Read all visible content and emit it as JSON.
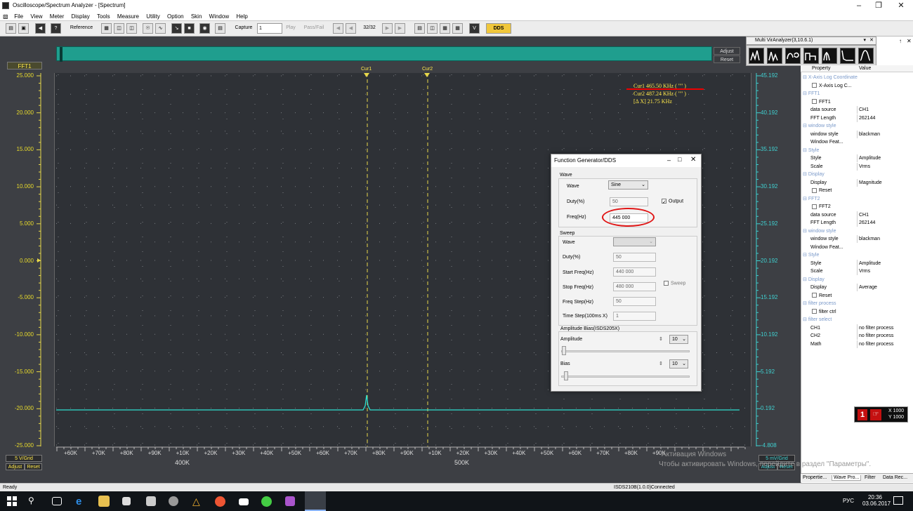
{
  "window": {
    "title": "Oscilloscope/Spectrum Analyzer - [Spectrum]"
  },
  "menu": [
    "File",
    "View",
    "Meter",
    "Display",
    "Tools",
    "Measure",
    "Utility",
    "Option",
    "Skin",
    "Window",
    "Help"
  ],
  "toolbar": {
    "reference": "Reference",
    "capture": "Capture",
    "capture_value": "1",
    "play": "Play",
    "pass_fail": "Pass/Fail",
    "frame": "32/32",
    "dds": "DDS"
  },
  "plot": {
    "channel_label": "FFT1",
    "y_left": [
      "25.000",
      "20.000",
      "15.000",
      "10.000",
      "5.000",
      "0.000",
      "-5.000",
      "-10.000",
      "-15.000",
      "-20.000",
      "-25.000"
    ],
    "y_right": [
      "45.192",
      "40.192",
      "35.192",
      "30.192",
      "25.192",
      "20.192",
      "15.192",
      "10.192",
      "5.192",
      "0.192",
      "-4.808"
    ],
    "x_ticks": [
      "+60K",
      "+70K",
      "+80K",
      "+90K",
      "+10K",
      "+20K",
      "+30K",
      "+40K",
      "+50K",
      "+60K",
      "+70K",
      "+80K",
      "+90K",
      "+10K",
      "+20K",
      "+30K",
      "+40K",
      "+50K",
      "+60K",
      "+70K",
      "+80K",
      "+90K"
    ],
    "x_groups": [
      "400K",
      "500K"
    ],
    "left_grid": "5 V/Grid",
    "right_grid": "5 mV/Grid",
    "adjust": "Adjust",
    "reset": "Reset",
    "cur1_tag": "Cur1",
    "cur2_tag": "Cur2",
    "cur1_line": "Cur1   465.50 KHz ( \"\" )",
    "cur2_line": "Cur2   487.24 KHz ( \"\" )",
    "delta_line": "[Δ X]   21.75 KHz"
  },
  "watermark": {
    "line1": "Активация Windows",
    "line2": "Чтобы активировать Windows, перейдите в раздел \"Параметры\"."
  },
  "fg": {
    "title": "Function Generator/DDS",
    "wave_group": "Wave",
    "wave_label": "Wave",
    "wave_value": "Sine",
    "duty_label": "Duty(%)",
    "duty_value": "50",
    "output_label": "Output",
    "freq_label": "Freq(Hz)",
    "freq_value": "445 000",
    "sweep_group": "Sweep",
    "s_wave": "Wave",
    "s_duty": "Duty(%)",
    "s_duty_value": "50",
    "start_label": "Start Freq(Hz)",
    "start_value": "440 000",
    "stop_label": "Stop Freq(Hz)",
    "stop_value": "480 000",
    "sweep_chk": "Sweep",
    "step_label": "Freq Step(Hz)",
    "step_value": "50",
    "time_label": "Time Step(100ms X)",
    "time_value": "1",
    "amp_group": "Amplitude Bias(ISDS205X)",
    "amp_label": "Amplitude",
    "amp_value": "10",
    "bias_label": "Bias",
    "bias_value": "10"
  },
  "mva": {
    "title": "Multi VirAnalyzer(3,10.6.1)"
  },
  "props": {
    "col_property": "Property",
    "col_value": "Value",
    "rows": [
      {
        "k": "X-Axis Log Coordinate",
        "v": "",
        "cat": true
      },
      {
        "k": "X-Axis Log C...",
        "v": "",
        "chk": true
      },
      {
        "k": "FFT1",
        "v": "",
        "cat": true
      },
      {
        "k": "FFT1",
        "v": "",
        "chk": true
      },
      {
        "k": "data source",
        "v": "CH1"
      },
      {
        "k": "FFT Length",
        "v": "262144"
      },
      {
        "k": "window style",
        "v": "",
        "cat": true
      },
      {
        "k": "window style",
        "v": "blackman"
      },
      {
        "k": "Window Feat...",
        "v": ""
      },
      {
        "k": "Style",
        "v": "",
        "cat": true
      },
      {
        "k": "Style",
        "v": "Amplitude"
      },
      {
        "k": "Scale",
        "v": "Vrms"
      },
      {
        "k": "Display",
        "v": "",
        "cat": true
      },
      {
        "k": "Display",
        "v": "Magnitude"
      },
      {
        "k": "Reset",
        "v": "",
        "chk": true
      },
      {
        "k": "FFT2",
        "v": "",
        "cat": true
      },
      {
        "k": "FFT2",
        "v": "",
        "chk": true
      },
      {
        "k": "data source",
        "v": "CH1"
      },
      {
        "k": "FFT Length",
        "v": "262144"
      },
      {
        "k": "window style",
        "v": "",
        "cat": true
      },
      {
        "k": "window style",
        "v": "blackman"
      },
      {
        "k": "Window Feat...",
        "v": ""
      },
      {
        "k": "Style",
        "v": "",
        "cat": true
      },
      {
        "k": "Style",
        "v": "Amplitude"
      },
      {
        "k": "Scale",
        "v": "Vrms"
      },
      {
        "k": "Display",
        "v": "",
        "cat": true
      },
      {
        "k": "Display",
        "v": "Average"
      },
      {
        "k": "Reset",
        "v": "",
        "chk": true
      },
      {
        "k": "filter process",
        "v": "",
        "cat": true
      },
      {
        "k": "filter ctrl",
        "v": "",
        "chk": true
      },
      {
        "k": "filter select",
        "v": "",
        "cat": true
      },
      {
        "k": "CH1",
        "v": "no filter process"
      },
      {
        "k": "CH2",
        "v": "no filter process"
      },
      {
        "k": "Math",
        "v": "no filter process"
      }
    ],
    "tabs": [
      "Propertie...",
      "Wave Pro...",
      "Filter",
      "Data Rec..."
    ]
  },
  "reticle": {
    "x": "X 1000",
    "y": "Y 1000"
  },
  "status": {
    "left": "Ready",
    "mid": "ISDS210B(1.0.0)Connected"
  },
  "taskbar": {
    "lang": "РУС",
    "time": "20:36",
    "date": "03.06.2017"
  }
}
